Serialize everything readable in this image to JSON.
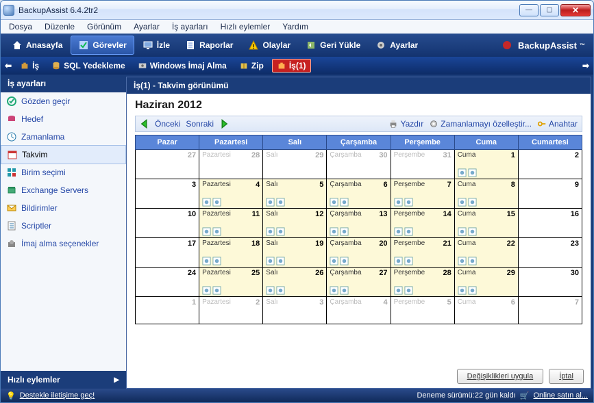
{
  "title": "BackupAssist 6.4.2tr2",
  "menus": [
    "Dosya",
    "Düzenle",
    "Görünüm",
    "Ayarlar",
    "İş ayarları",
    "Hızlı eylemler",
    "Yardım"
  ],
  "maintabs": [
    {
      "label": "Anasayfa"
    },
    {
      "label": "Görevler",
      "active": true
    },
    {
      "label": "İzle"
    },
    {
      "label": "Raporlar"
    },
    {
      "label": "Olaylar"
    },
    {
      "label": "Geri Yükle"
    },
    {
      "label": "Ayarlar"
    }
  ],
  "brand": "BackupAssist",
  "subtool": [
    {
      "label": "İş"
    },
    {
      "label": "SQL Yedekleme"
    },
    {
      "label": "Windows İmaj Alma"
    },
    {
      "label": "Zip"
    },
    {
      "label": "İş(1)",
      "active": true
    }
  ],
  "sidebar_header": "İş ayarları",
  "sidebar": [
    {
      "label": "Gözden geçir",
      "color": "#2346a6"
    },
    {
      "label": "Hedef",
      "color": "#2346a6"
    },
    {
      "label": "Zamanlama",
      "color": "#2346a6"
    },
    {
      "label": "Takvim",
      "active": true,
      "color": "#000"
    },
    {
      "label": "Birim seçimi",
      "color": "#2346a6"
    },
    {
      "label": "Exchange Servers",
      "color": "#2346a6"
    },
    {
      "label": "Bildirimler",
      "color": "#2346a6"
    },
    {
      "label": "Scriptler",
      "color": "#2346a6"
    },
    {
      "label": "İmaj alma seçenekler",
      "color": "#2346a6"
    }
  ],
  "side_action": "Hızlı eylemler",
  "content_header": "İş(1) - Takvim görünümü",
  "month": "Haziran 2012",
  "nav": {
    "prev": "Önceki",
    "next": "Sonraki"
  },
  "tool2": {
    "print": "Yazdır",
    "custom": "Zamanlamayı özelleştir...",
    "key": "Anahtar"
  },
  "dow": [
    "Pazar",
    "Pazartesi",
    "Salı",
    "Çarşamba",
    "Perşembe",
    "Cuma",
    "Cumartesi"
  ],
  "weeks": [
    [
      {
        "n": 27,
        "other": true
      },
      {
        "n": 28,
        "other": true,
        "lbl": "Pazartesi"
      },
      {
        "n": 29,
        "other": true,
        "lbl": "Salı"
      },
      {
        "n": 30,
        "other": true,
        "lbl": "Çarşamba"
      },
      {
        "n": 31,
        "other": true,
        "lbl": "Perşembe"
      },
      {
        "n": 1,
        "hl": true,
        "lbl": "Cuma",
        "ic": true
      },
      {
        "n": 2
      }
    ],
    [
      {
        "n": 3
      },
      {
        "n": 4,
        "hl": true,
        "lbl": "Pazartesi",
        "ic": true
      },
      {
        "n": 5,
        "hl": true,
        "lbl": "Salı",
        "ic": true
      },
      {
        "n": 6,
        "hl": true,
        "lbl": "Çarşamba",
        "ic": true
      },
      {
        "n": 7,
        "hl": true,
        "lbl": "Perşembe",
        "ic": true
      },
      {
        "n": 8,
        "hl": true,
        "lbl": "Cuma",
        "ic": true
      },
      {
        "n": 9
      }
    ],
    [
      {
        "n": 10
      },
      {
        "n": 11,
        "hl": true,
        "lbl": "Pazartesi",
        "ic": true
      },
      {
        "n": 12,
        "hl": true,
        "lbl": "Salı",
        "ic": true
      },
      {
        "n": 13,
        "hl": true,
        "lbl": "Çarşamba",
        "ic": true
      },
      {
        "n": 14,
        "hl": true,
        "lbl": "Perşembe",
        "ic": true
      },
      {
        "n": 15,
        "hl": true,
        "lbl": "Cuma",
        "ic": true
      },
      {
        "n": 16
      }
    ],
    [
      {
        "n": 17
      },
      {
        "n": 18,
        "hl": true,
        "lbl": "Pazartesi",
        "ic": true
      },
      {
        "n": 19,
        "hl": true,
        "lbl": "Salı",
        "ic": true
      },
      {
        "n": 20,
        "hl": true,
        "lbl": "Çarşamba",
        "ic": true
      },
      {
        "n": 21,
        "hl": true,
        "lbl": "Perşembe",
        "ic": true
      },
      {
        "n": 22,
        "hl": true,
        "lbl": "Cuma",
        "ic": true
      },
      {
        "n": 23
      }
    ],
    [
      {
        "n": 24
      },
      {
        "n": 25,
        "hl": true,
        "lbl": "Pazartesi",
        "ic": true
      },
      {
        "n": 26,
        "hl": true,
        "lbl": "Salı",
        "ic": true
      },
      {
        "n": 27,
        "hl": true,
        "lbl": "Çarşamba",
        "ic": true
      },
      {
        "n": 28,
        "hl": true,
        "lbl": "Perşembe",
        "ic": true
      },
      {
        "n": 29,
        "hl": true,
        "lbl": "Cuma",
        "ic": true
      },
      {
        "n": 30
      }
    ],
    [
      {
        "n": 1,
        "other": true
      },
      {
        "n": 2,
        "other": true,
        "lbl": "Pazartesi"
      },
      {
        "n": 3,
        "other": true,
        "lbl": "Salı"
      },
      {
        "n": 4,
        "other": true,
        "lbl": "Çarşamba"
      },
      {
        "n": 5,
        "other": true,
        "lbl": "Perşembe"
      },
      {
        "n": 6,
        "other": true,
        "lbl": "Cuma"
      },
      {
        "n": 7,
        "other": true
      }
    ]
  ],
  "buttons": {
    "apply": "Değişiklikleri uygula",
    "cancel": "İptal"
  },
  "status": {
    "support": "Destekle iletişime geç!",
    "trial": "Deneme sürümü:22 gün kaldı",
    "buy": "Online satın al..."
  },
  "iconColors": {
    "home": "#fff",
    "tasks": "#b8d4ff",
    "monitor": "#b8d4ff",
    "reports": "#fff",
    "events": "#ffcc00",
    "restore": "#b8d4ff",
    "settings": "#ffcc00"
  }
}
